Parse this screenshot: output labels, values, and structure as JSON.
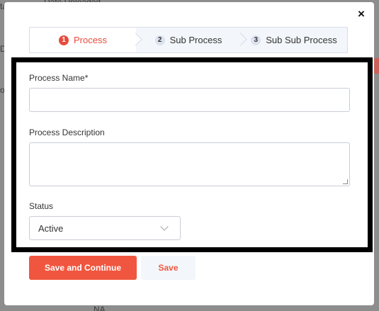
{
  "background": {
    "top_text": "Date Uploaded",
    "left_fragments": [
      "ta",
      "o",
      "D"
    ],
    "bottom_text": "NA"
  },
  "modal": {
    "close_glyph": "×",
    "steps": [
      {
        "number": "1",
        "label": "Process"
      },
      {
        "number": "2",
        "label": "Sub Process"
      },
      {
        "number": "3",
        "label": "Sub Sub Process"
      }
    ],
    "fields": {
      "process_name_label": "Process Name*",
      "process_name_value": "",
      "process_description_label": "Process Description",
      "process_description_value": "",
      "status_label": "Status",
      "status_value": "Active"
    },
    "buttons": {
      "save_continue": "Save and Continue",
      "save": "Save"
    }
  },
  "colors": {
    "accent": "#f0563f",
    "active_step_text": "#e84b3c",
    "frame": "#000000"
  },
  "icons": {
    "close": "close-icon",
    "select_arrow": "chevron-down-icon"
  }
}
